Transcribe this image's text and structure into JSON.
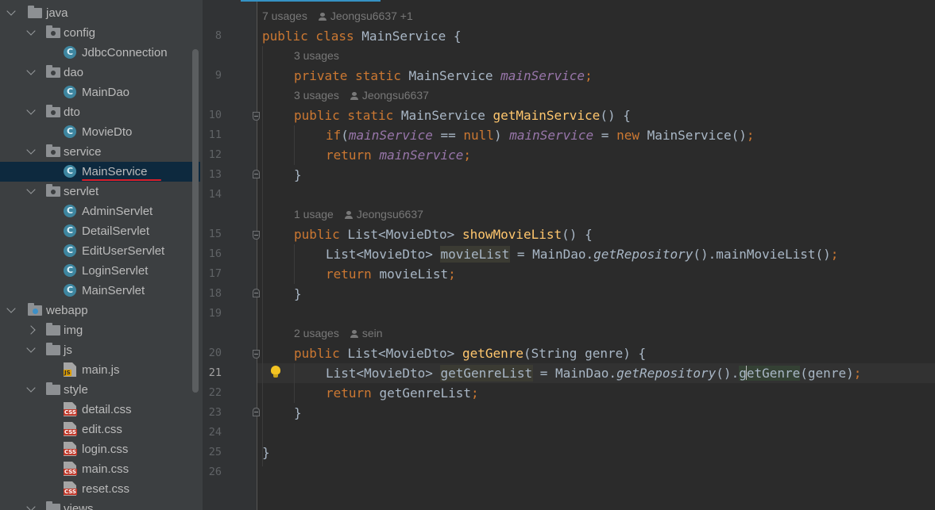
{
  "tree": {
    "items": [
      {
        "label": "java",
        "depth": 0,
        "type": "source-folder",
        "state": "open"
      },
      {
        "label": "config",
        "depth": 1,
        "type": "package",
        "state": "open"
      },
      {
        "label": "JdbcConnection",
        "depth": 2,
        "type": "class"
      },
      {
        "label": "dao",
        "depth": 1,
        "type": "package",
        "state": "open"
      },
      {
        "label": "MainDao",
        "depth": 2,
        "type": "class"
      },
      {
        "label": "dto",
        "depth": 1,
        "type": "package",
        "state": "open"
      },
      {
        "label": "MovieDto",
        "depth": 2,
        "type": "class"
      },
      {
        "label": "service",
        "depth": 1,
        "type": "package",
        "state": "open"
      },
      {
        "label": "MainService",
        "depth": 2,
        "type": "class",
        "selected": true
      },
      {
        "label": "servlet",
        "depth": 1,
        "type": "package",
        "state": "open"
      },
      {
        "label": "AdminServlet",
        "depth": 2,
        "type": "class"
      },
      {
        "label": "DetailServlet",
        "depth": 2,
        "type": "class"
      },
      {
        "label": "EditUserServlet",
        "depth": 2,
        "type": "class"
      },
      {
        "label": "LoginServlet",
        "depth": 2,
        "type": "class"
      },
      {
        "label": "MainServlet",
        "depth": 2,
        "type": "class"
      },
      {
        "label": "webapp",
        "depth": 0,
        "type": "web-folder",
        "state": "open"
      },
      {
        "label": "img",
        "depth": 1,
        "type": "folder",
        "state": "closed"
      },
      {
        "label": "js",
        "depth": 1,
        "type": "folder",
        "state": "open"
      },
      {
        "label": "main.js",
        "depth": 2,
        "type": "js"
      },
      {
        "label": "style",
        "depth": 1,
        "type": "folder",
        "state": "open"
      },
      {
        "label": "detail.css",
        "depth": 2,
        "type": "css"
      },
      {
        "label": "edit.css",
        "depth": 2,
        "type": "css"
      },
      {
        "label": "login.css",
        "depth": 2,
        "type": "css"
      },
      {
        "label": "main.css",
        "depth": 2,
        "type": "css"
      },
      {
        "label": "reset.css",
        "depth": 2,
        "type": "css"
      },
      {
        "label": "views",
        "depth": 1,
        "type": "folder",
        "state": "open"
      }
    ]
  },
  "editor": {
    "class_hint": {
      "usages": "7 usages",
      "author": "Jeongsu6637 +1"
    },
    "field_hint": {
      "usages": "3 usages"
    },
    "getMainService_hint": {
      "usages": "3 usages",
      "author": "Jeongsu6637"
    },
    "showMovieList_hint": {
      "usages": "1 usage",
      "author": "Jeongsu6637"
    },
    "getGenre_hint": {
      "usages": "2 usages",
      "author": "sein"
    },
    "line_numbers": [
      "8",
      "9",
      "10",
      "11",
      "12",
      "13",
      "14",
      "15",
      "16",
      "17",
      "18",
      "19",
      "20",
      "21",
      "22",
      "23",
      "24",
      "25",
      "26"
    ],
    "current_line": "21",
    "code": {
      "l8_kw": "public class ",
      "l8_name": "MainService",
      "l8_rest": " {",
      "l9_kw": "private static ",
      "l9_type": "MainService ",
      "l9_field": "mainService",
      "l9_semi": ";",
      "l10_kw": "public static ",
      "l10_type": "MainService ",
      "l10_fn": "getMainService",
      "l10_rest": "() {",
      "l11_kw1": "if",
      "l11_p": "(",
      "l11_f1": "mainService",
      "l11_eq": " == ",
      "l11_null": "null",
      "l11_cp": ") ",
      "l11_f2": "mainService",
      "l11_as": " = ",
      "l11_new": "new ",
      "l11_ctor": "MainService()",
      "l11_semi": ";",
      "l12_kw": "return ",
      "l12_f": "mainService",
      "l12_semi": ";",
      "l13": "}",
      "l15_kw": "public ",
      "l15_type": "List<MovieDto> ",
      "l15_fn": "showMovieList",
      "l15_rest": "() {",
      "l16_type": "List<MovieDto> ",
      "l16_var": "movieList",
      "l16_a": " = MainDao.",
      "l16_m": "getRepository",
      "l16_b": "().mainMovieList()",
      "l16_semi": ";",
      "l17_kw": "return ",
      "l17_v": "movieList",
      "l17_semi": ";",
      "l18": "}",
      "l20_kw": "public ",
      "l20_type": "List<MovieDto> ",
      "l20_fn": "getGenre",
      "l20_rest": "(String genre) {",
      "l21_type": "List<MovieDto> ",
      "l21_var": "getGenreList",
      "l21_a": " = MainDao.",
      "l21_m": "getRepository",
      "l21_b": "().",
      "l21_c1": "g",
      "l21_c2": "etGenre",
      "l21_d": "(genre)",
      "l21_semi": ";",
      "l22_kw": "return ",
      "l22_v": "getGenreList",
      "l22_semi": ";",
      "l23": "}",
      "l25": "}"
    }
  }
}
